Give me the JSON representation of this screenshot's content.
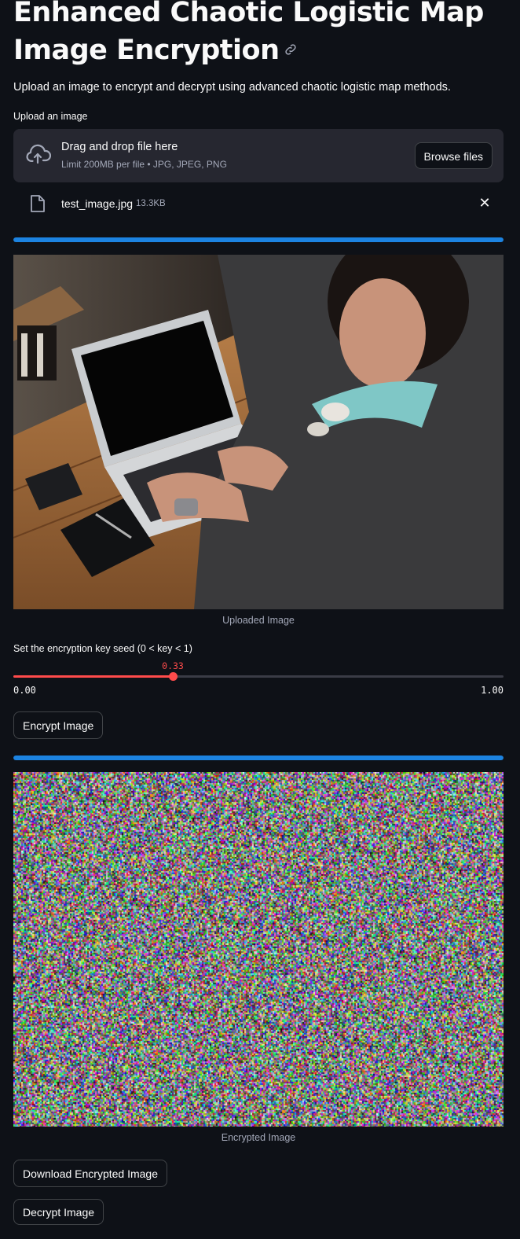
{
  "header": {
    "title": "Enhanced Chaotic Logistic Map Image Encryption",
    "subtitle": "Upload an image to encrypt and decrypt using advanced chaotic logistic map methods."
  },
  "uploader": {
    "label": "Upload an image",
    "drop_text": "Drag and drop file here",
    "limit_text": "Limit 200MB per file • JPG, JPEG, PNG",
    "browse_label": "Browse files",
    "file": {
      "name": "test_image.jpg",
      "size": "13.3KB"
    }
  },
  "progress": {
    "upload": 1.0,
    "encrypt": 1.0
  },
  "uploaded_image": {
    "caption": "Uploaded Image"
  },
  "slider": {
    "label": "Set the encryption key seed (0 < key < 1)",
    "value": "0.33",
    "value_num": 0.33,
    "min": "0.00",
    "max": "1.00"
  },
  "buttons": {
    "encrypt": "Encrypt Image",
    "download": "Download Encrypted Image",
    "decrypt": "Decrypt Image"
  },
  "encrypted_image": {
    "caption": "Encrypted Image"
  },
  "colors": {
    "accent": "#ff4b4b",
    "progress": "#1c83e1",
    "background": "#0e1117",
    "panel": "#262730"
  }
}
